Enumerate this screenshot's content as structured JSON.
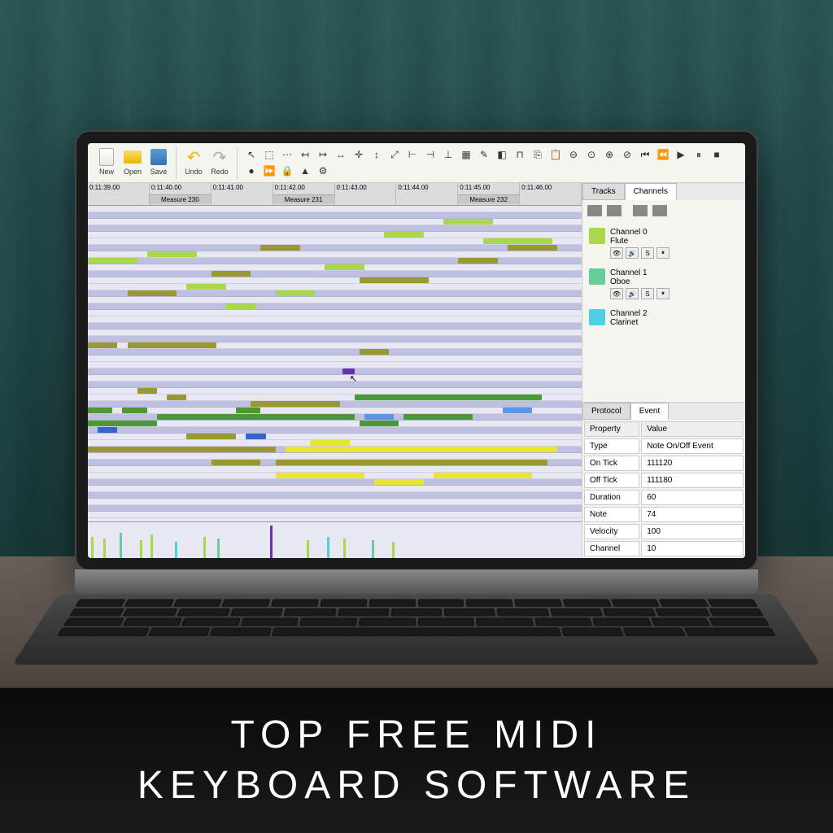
{
  "toolbar": {
    "new": "New",
    "open": "Open",
    "save": "Save",
    "undo": "Undo",
    "redo": "Redo"
  },
  "timeline": {
    "times": [
      "0:11:39.00",
      "0:11:40.00",
      "0:11:41.00",
      "0:11:42.00",
      "0:11:43.00",
      "0:11:44.00",
      "0:11:45.00",
      "0:11:46.00"
    ],
    "measures": [
      "Measure 230",
      "Measure 231",
      "Measure 232"
    ]
  },
  "tabs": {
    "tracks": "Tracks",
    "channels": "Channels"
  },
  "channels": [
    {
      "name": "Channel 0",
      "instrument": "Flute",
      "color": "#aad84c",
      "solo": "S"
    },
    {
      "name": "Channel 1",
      "instrument": "Oboe",
      "color": "#66cc99",
      "solo": "S"
    },
    {
      "name": "Channel 2",
      "instrument": "Clarinet",
      "color": "#4dd0e1",
      "solo": ""
    }
  ],
  "event": {
    "tabs": {
      "protocol": "Protocol",
      "event": "Event"
    },
    "headers": {
      "property": "Property",
      "value": "Value"
    },
    "rows": [
      {
        "prop": "Type",
        "val": "Note On/Off Event"
      },
      {
        "prop": "On Tick",
        "val": "111120"
      },
      {
        "prop": "Off Tick",
        "val": "111180"
      },
      {
        "prop": "Duration",
        "val": "60"
      },
      {
        "prop": "Note",
        "val": "74"
      },
      {
        "prop": "Velocity",
        "val": "100"
      },
      {
        "prop": "Channel",
        "val": "10"
      }
    ]
  },
  "caption": {
    "line1": "TOP FREE MIDI",
    "line2": "KEYBOARD SOFTWARE"
  }
}
